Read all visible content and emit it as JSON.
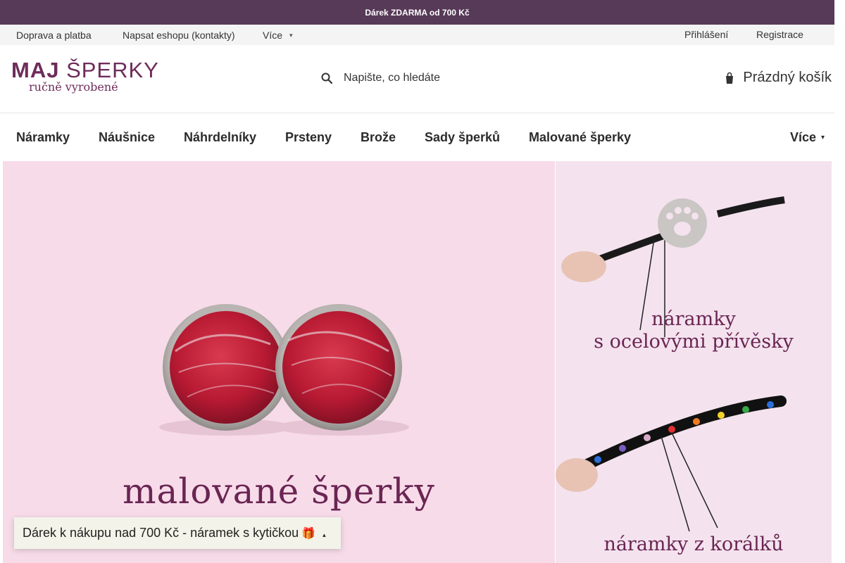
{
  "announcement": "Dárek ZDARMA od 700 Kč",
  "top_nav": {
    "links": [
      "Doprava a platba",
      "Napsat eshopu (kontakty)",
      "Více"
    ],
    "login": "Přihlášení",
    "register": "Registrace"
  },
  "logo": {
    "main_bold": "MAJ",
    "main_light": "ŠPERKY",
    "sub": "ručně vyrobené"
  },
  "search": {
    "placeholder": "Napište, co hledáte",
    "icon": "search-icon"
  },
  "cart": {
    "label": "Prázdný košík",
    "icon": "cart-icon"
  },
  "main_nav": {
    "items": [
      "Náramky",
      "Náušnice",
      "Náhrdelníky",
      "Prsteny",
      "Brože",
      "Sady šperků",
      "Malované šperky"
    ],
    "more": "Více"
  },
  "banners": {
    "hero_title": "malované šperky",
    "side1_line1": "náramky",
    "side1_line2": "s ocelovými přívěsky",
    "side2_title": "náramky z korálků"
  },
  "gift_bar": "Dárek k nákupu nad 700 Kč - náramek s kytičkou",
  "colors": {
    "brand": "#573a57",
    "logo": "#6e2c5a",
    "hero_bg": "#f7dbe9"
  }
}
